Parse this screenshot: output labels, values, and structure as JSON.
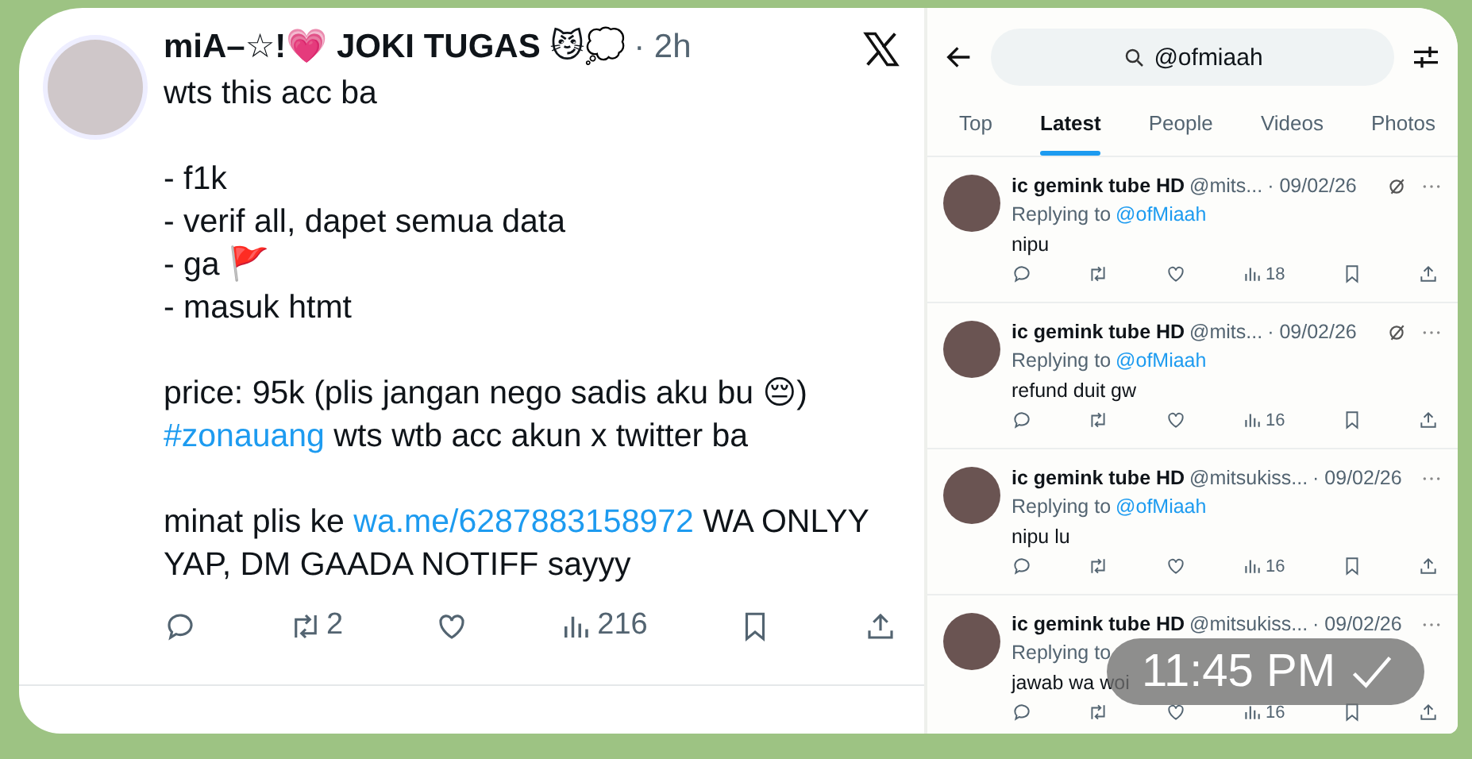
{
  "tweet": {
    "name": "miA–☆!💗 JOKI TUGAS 😼💭",
    "time": "· 2h",
    "paragraphs": [
      [
        [
          {
            "kind": "text",
            "text": "wts this acc ba"
          }
        ]
      ],
      [
        [
          {
            "kind": "text",
            "text": "- f1k"
          }
        ],
        [
          {
            "kind": "text",
            "text": "- verif all, dapet semua data"
          }
        ],
        [
          {
            "kind": "text",
            "text": "- ga 🚩"
          }
        ],
        [
          {
            "kind": "text",
            "text": "- masuk htmt"
          }
        ]
      ],
      [
        [
          {
            "kind": "text",
            "text": "price: 95k (plis jangan nego sadis aku bu 😔)"
          }
        ],
        [
          {
            "kind": "link",
            "text": "#zonauang"
          },
          {
            "kind": "text",
            "text": " wts wtb acc akun x twitter ba"
          }
        ]
      ],
      [
        [
          {
            "kind": "text",
            "text": "minat plis ke "
          },
          {
            "kind": "link",
            "text": "wa.me/6287883158972"
          },
          {
            "kind": "text",
            "text": " WA ONLYY YAP, DM GAADA NOTIFF sayyy"
          }
        ]
      ]
    ],
    "actions": [
      {
        "kind": "reply"
      },
      {
        "kind": "repost",
        "count": "2"
      },
      {
        "kind": "like"
      },
      {
        "kind": "views",
        "count": "216"
      },
      {
        "kind": "bookmark"
      },
      {
        "kind": "share"
      }
    ]
  },
  "search": {
    "value": "@ofmiaah"
  },
  "tabs": [
    {
      "label": "Top",
      "selected": false
    },
    {
      "label": "Latest",
      "selected": true
    },
    {
      "label": "People",
      "selected": false
    },
    {
      "label": "Videos",
      "selected": false
    },
    {
      "label": "Photos",
      "selected": false
    }
  ],
  "replies": [
    {
      "name": "ic gemink tube HD",
      "handle": "@mits...",
      "date": "· 09/02/26",
      "grok": true,
      "replying": "Replying to",
      "mention": "@ofMiaah",
      "text": "nipu",
      "views": "18"
    },
    {
      "name": "ic gemink tube HD",
      "handle": "@mits...",
      "date": "· 09/02/26",
      "grok": true,
      "replying": "Replying to",
      "mention": "@ofMiaah",
      "text": "refund duit gw",
      "views": "16"
    },
    {
      "name": "ic gemink tube HD",
      "handle": "@mitsukiss...",
      "date": "· 09/02/26",
      "grok": false,
      "replying": "Replying to",
      "mention": "@ofMiaah",
      "text": "nipu lu",
      "views": "16"
    },
    {
      "name": "ic gemink tube HD",
      "handle": "@mitsukiss...",
      "date": "· 09/02/26",
      "grok": false,
      "replying": "Replying to",
      "text": "jawab wa woi",
      "views": "16"
    }
  ],
  "message_time": "11:45 PM"
}
